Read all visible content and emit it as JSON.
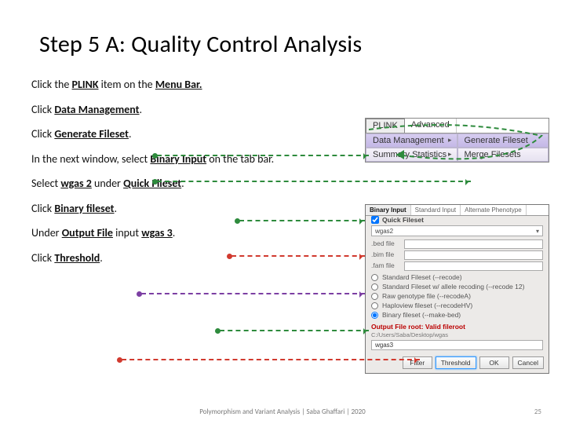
{
  "title": "Step 5 A: Quality Control Analysis",
  "bullets": {
    "b1_pre": "Click the ",
    "b1_s1": "PLINK",
    "b1_mid": " item on the ",
    "b1_s2": "Menu Bar.",
    "b2_pre": "Click ",
    "b2_s1": "Data Management",
    "b2_post": ".",
    "b3_pre": "Click ",
    "b3_s1": "Generate Fileset",
    "b3_post": ".",
    "b4_pre": "In the next window, select ",
    "b4_s1": "Binary Input",
    "b4_post": " on the tab bar.",
    "b5_pre": "Select ",
    "b5_s1": "wgas 2",
    "b5_mid": " under ",
    "b5_s2": "Quick Fileset",
    "b5_post": ".",
    "b6_pre": "Click ",
    "b6_s1": "Binary fileset",
    "b6_post": ".",
    "b7_pre": "Under ",
    "b7_s1": "Output File",
    "b7_mid": " input ",
    "b7_s2": "wgas 3",
    "b7_post": ".",
    "b8_pre": "Click ",
    "b8_s1": "Threshold",
    "b8_post": "."
  },
  "menu": {
    "m1": "PLINK",
    "m2": "Advanced",
    "dm": "Data Management",
    "ss": "Summary Statistics",
    "gf": "Generate Fileset",
    "mf": "Merge Filesets"
  },
  "dialog": {
    "tabs": {
      "t1": "Binary Input",
      "t2": "Standard Input",
      "t3": "Alternate Phenotype"
    },
    "quick": "Quick Fileset",
    "wgas2": "wgas2",
    "bed": ".bed file",
    "bim": ".bim file",
    "fam": ".fam file",
    "r1": "Standard Fileset (--recode)",
    "r2": "Standard Fileset w/ allele recoding (--recode 12)",
    "r3": "Raw genotype file (--recodeA)",
    "r4": "Haploview fileset (--recodeHV)",
    "r5": "Binary fileset (--make-bed)",
    "out": "Output File root: Valid fileroot",
    "outsub": "C:/Users/Saba/Desktop/wgas",
    "wgas3": "wgas3",
    "btn_filter": "Filter",
    "btn_threshold": "Threshold",
    "btn_ok": "OK",
    "btn_cancel": "Cancel"
  },
  "footer": "Polymorphism and Variant Analysis | Saba Ghaffari | 2020",
  "page": "25"
}
